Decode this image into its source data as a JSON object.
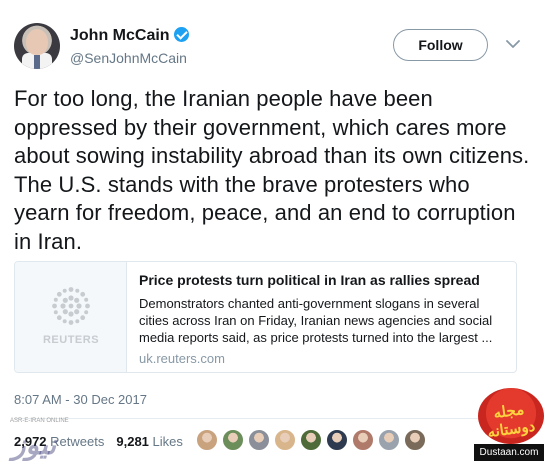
{
  "tweet": {
    "author_name": "John McCain",
    "author_handle": "@SenJohnMcCain",
    "follow_label": "Follow",
    "text": "For too long, the Iranian people have been oppressed by their government, which cares more about sowing instability abroad than its own citizens. The U.S. stands with the brave protesters who yearn for freedom, peace, and an end to corruption in Iran.",
    "timestamp": "8:07 AM - 30 Dec 2017",
    "retweets_count": "2,972",
    "retweets_label": "Retweets",
    "likes_count": "9,281",
    "likes_label": "Likes"
  },
  "card": {
    "title": "Price protests turn political in Iran as rallies spread",
    "description": "Demonstrators chanted anti-government slogans in several cities across Iran on Friday, Iranian news agencies and social media reports said, as price protests turned into the largest ...",
    "domain": "uk.reuters.com",
    "thumb_label": "REUTERS"
  },
  "liker_colors": [
    "#c9a27e",
    "#6b8e5a",
    "#8a8f99",
    "#d9b58c",
    "#4f6b3a",
    "#2e3a4f",
    "#b07a6a",
    "#9aa3ad",
    "#7a6a5a"
  ],
  "watermarks": {
    "left_small": "ASR-E-IRAN ONLINE",
    "left_text": "نیوز",
    "right_text": "مجله دوستانه",
    "right_site": "Dustaan.com"
  },
  "icons": {
    "verified": "verified-badge-icon",
    "chevron": "chevron-down-icon",
    "reuters": "reuters-logo-icon"
  },
  "colors": {
    "accent": "#1da1f2",
    "muted": "#657786",
    "text": "#14171a"
  }
}
